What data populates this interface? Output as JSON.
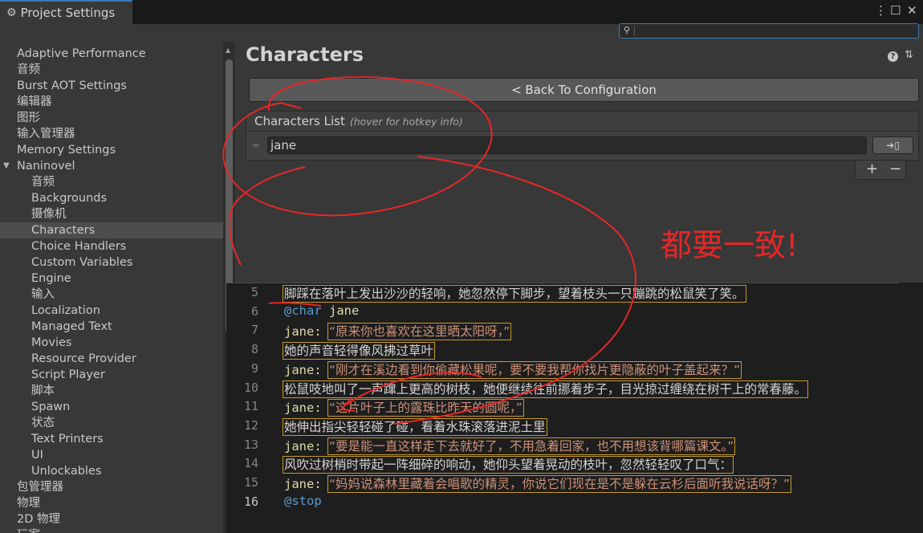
{
  "window": {
    "title": "Project Settings"
  },
  "sidebar": {
    "items": [
      {
        "label": "Adaptive Performance",
        "level": 0
      },
      {
        "label": "音频",
        "level": 0
      },
      {
        "label": "Burst AOT Settings",
        "level": 0
      },
      {
        "label": "编辑器",
        "level": 0
      },
      {
        "label": "图形",
        "level": 0
      },
      {
        "label": "输入管理器",
        "level": 0
      },
      {
        "label": "Memory Settings",
        "level": 0
      },
      {
        "label": "Naninovel",
        "level": 0,
        "expanded": true
      },
      {
        "label": "音频",
        "level": 1
      },
      {
        "label": "Backgrounds",
        "level": 1
      },
      {
        "label": "摄像机",
        "level": 1
      },
      {
        "label": "Characters",
        "level": 1,
        "selected": true
      },
      {
        "label": "Choice Handlers",
        "level": 1
      },
      {
        "label": "Custom Variables",
        "level": 1
      },
      {
        "label": "Engine",
        "level": 1
      },
      {
        "label": "输入",
        "level": 1
      },
      {
        "label": "Localization",
        "level": 1
      },
      {
        "label": "Managed Text",
        "level": 1
      },
      {
        "label": "Movies",
        "level": 1
      },
      {
        "label": "Resource Provider",
        "level": 1
      },
      {
        "label": "Script Player",
        "level": 1
      },
      {
        "label": "脚本",
        "level": 1
      },
      {
        "label": "Spawn",
        "level": 1
      },
      {
        "label": "状态",
        "level": 1
      },
      {
        "label": "Text Printers",
        "level": 1
      },
      {
        "label": "UI",
        "level": 1
      },
      {
        "label": "Unlockables",
        "level": 1
      },
      {
        "label": "包管理器",
        "level": 0
      },
      {
        "label": "物理",
        "level": 0
      },
      {
        "label": "2D 物理",
        "level": 0
      },
      {
        "label": "玩家",
        "level": 0
      }
    ]
  },
  "main": {
    "title": "Characters",
    "help_icon": "?",
    "back_button": "< Back To Configuration",
    "list_header": "Characters List",
    "list_hint": "(hover for hotkey info)",
    "character_value": "jane",
    "add_label": "+",
    "remove_label": "−"
  },
  "annotation": {
    "text": "都要一致!",
    "color": "#e52727"
  },
  "editor": {
    "lines": [
      {
        "n": "5",
        "text": "脚踩在落叶上发出沙沙的轻响，她忽然停下脚步，望着枝头一只蹦跳的松鼠笑了笑。",
        "kind": "plain",
        "boxed": true
      },
      {
        "n": "6",
        "cmd": "@char",
        "arg": "jane",
        "kind": "command"
      },
      {
        "n": "7",
        "speaker": "jane:",
        "text": "“原来你也喜欢在这里晒太阳呀，”",
        "kind": "dialog",
        "boxed": true
      },
      {
        "n": "8",
        "text": "她的声音轻得像风拂过草叶",
        "kind": "plain",
        "boxed": true
      },
      {
        "n": "9",
        "speaker": "jane:",
        "text": "“刚才在溪边看到你偷藏松果呢，要不要我帮你找片更隐蔽的叶子盖起来？”",
        "kind": "dialog",
        "boxed": true
      },
      {
        "n": "10",
        "text": "松鼠吱地叫了一声蹿上更高的树枝，她便继续往前挪着步子，目光掠过缠绕在树干上的常春藤。",
        "kind": "plain",
        "boxed": true
      },
      {
        "n": "11",
        "speaker": "jane:",
        "text": "“这片叶子上的露珠比昨天的圆呢，”",
        "kind": "dialog",
        "boxed": true
      },
      {
        "n": "12",
        "text": "她伸出指尖轻轻碰了碰，看着水珠滚落进泥土里",
        "kind": "plain",
        "boxed": true
      },
      {
        "n": "13",
        "speaker": "jane:",
        "text": "“要是能一直这样走下去就好了，不用急着回家，也不用想该背哪篇课文。”",
        "kind": "dialog",
        "boxed": true
      },
      {
        "n": "14",
        "text": "风吹过树梢时带起一阵细碎的响动，她仰头望着晃动的枝叶，忽然轻轻叹了口气：",
        "kind": "plain",
        "boxed": true
      },
      {
        "n": "15",
        "speaker": "jane:",
        "text": "“妈妈说森林里藏着会唱歌的精灵，你说它们现在是不是躲在云杉后面听我说话呀？”",
        "kind": "dialog",
        "boxed": true
      },
      {
        "n": "16",
        "cmd": "@stop",
        "kind": "command",
        "current": true
      }
    ]
  },
  "icons": {
    "settings": "gear-icon",
    "menu": "kebab-menu-icon",
    "maximize": "maximize-icon",
    "close": "close-icon",
    "search": "search-icon",
    "help": "help-icon",
    "presets": "presets-icon",
    "open": "open-arrow-icon",
    "drag": "drag-handle-icon"
  },
  "colors": {
    "accent": "#3a79bb",
    "keyword": "#569cd6",
    "speaker": "#dcdcaa",
    "quote": "#ce9178",
    "box": "#c69a2a",
    "ink": "#e52727"
  }
}
